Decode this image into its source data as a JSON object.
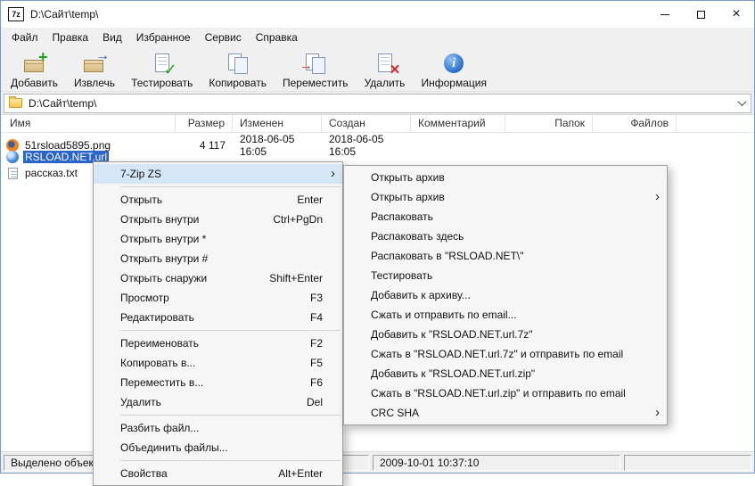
{
  "window": {
    "icon_text": "7z",
    "title": "D:\\Сайт\\temp\\"
  },
  "menubar": {
    "items": [
      "Файл",
      "Правка",
      "Вид",
      "Избранное",
      "Сервис",
      "Справка"
    ]
  },
  "toolbar": {
    "buttons": [
      {
        "label": "Добавить",
        "icon": "archive-add-icon"
      },
      {
        "label": "Извлечь",
        "icon": "archive-extract-icon"
      },
      {
        "label": "Тестировать",
        "icon": "test-check-icon"
      },
      {
        "label": "Копировать",
        "icon": "copy-files-icon"
      },
      {
        "label": "Переместить",
        "icon": "move-files-icon"
      },
      {
        "label": "Удалить",
        "icon": "delete-icon"
      },
      {
        "label": "Информация",
        "icon": "info-icon"
      }
    ]
  },
  "addressbar": {
    "path": "D:\\Сайт\\temp\\"
  },
  "filelist": {
    "columns": [
      "Имя",
      "Размер",
      "Изменен",
      "Создан",
      "Комментарий",
      "Папок",
      "Файлов"
    ],
    "rows": [
      {
        "icon": "firefox-image-icon",
        "name": "51rsload5895.png",
        "size": "4 117",
        "modified": "2018-06-05 16:05",
        "created": "2018-06-05 16:05",
        "selected": false
      },
      {
        "icon": "internet-shortcut-icon",
        "name": "RSLOAD.NET.url",
        "size": "",
        "modified": "",
        "created": "",
        "selected": true
      },
      {
        "icon": "text-file-icon",
        "name": "рассказ.txt",
        "size": "",
        "modified": "",
        "created": "",
        "selected": false
      }
    ]
  },
  "context_menu": {
    "items": [
      {
        "label": "7-Zip ZS",
        "shortcut": "",
        "submenu": true,
        "highlighted": true
      },
      {
        "label": "Открыть",
        "shortcut": "Enter"
      },
      {
        "label": "Открыть внутри",
        "shortcut": "Ctrl+PgDn"
      },
      {
        "label": "Открыть внутри *",
        "shortcut": ""
      },
      {
        "label": "Открыть внутри #",
        "shortcut": ""
      },
      {
        "label": "Открыть снаружи",
        "shortcut": "Shift+Enter"
      },
      {
        "label": "Просмотр",
        "shortcut": "F3"
      },
      {
        "label": "Редактировать",
        "shortcut": "F4"
      },
      {
        "label": "Переименовать",
        "shortcut": "F2"
      },
      {
        "label": "Копировать в...",
        "shortcut": "F5"
      },
      {
        "label": "Переместить в...",
        "shortcut": "F6"
      },
      {
        "label": "Удалить",
        "shortcut": "Del"
      },
      {
        "label": "Разбить файл...",
        "shortcut": ""
      },
      {
        "label": "Объединить файлы...",
        "shortcut": ""
      },
      {
        "label": "Свойства",
        "shortcut": "Alt+Enter"
      }
    ]
  },
  "submenu": {
    "items": [
      {
        "label": "Открыть архив",
        "submenu": false
      },
      {
        "label": "Открыть архив",
        "submenu": true
      },
      {
        "label": "Распаковать",
        "submenu": false
      },
      {
        "label": "Распаковать здесь",
        "submenu": false
      },
      {
        "label": "Распаковать в \"RSLOAD.NET\\\"",
        "submenu": false
      },
      {
        "label": "Тестировать",
        "submenu": false
      },
      {
        "label": "Добавить к архиву...",
        "submenu": false
      },
      {
        "label": "Сжать и отправить по email...",
        "submenu": false
      },
      {
        "label": "Добавить к \"RSLOAD.NET.url.7z\"",
        "submenu": false
      },
      {
        "label": "Сжать в \"RSLOAD.NET.url.7z\" и отправить по email",
        "submenu": false
      },
      {
        "label": "Добавить к \"RSLOAD.NET.url.zip\"",
        "submenu": false
      },
      {
        "label": "Сжать в \"RSLOAD.NET.url.zip\" и отправить по email",
        "submenu": false
      },
      {
        "label": "CRC SHA",
        "submenu": true
      }
    ]
  },
  "statusbar": {
    "selection_text": "Выделено объект",
    "timestamp": "2009-10-01 10:37:10"
  },
  "colors": {
    "selection": "#2a64c8",
    "menu_highlight": "#d5e7f7",
    "chrome": "#f0f0f0"
  }
}
